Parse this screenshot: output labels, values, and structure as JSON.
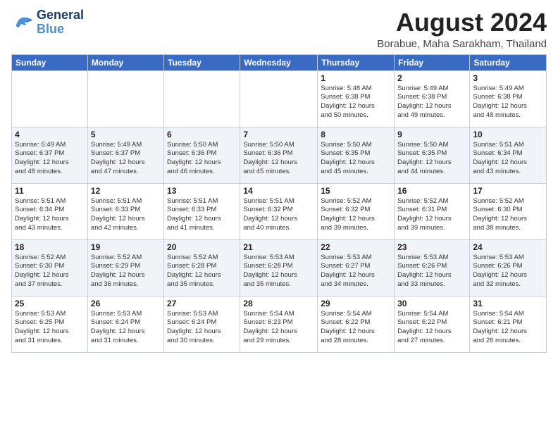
{
  "header": {
    "logo_line1": "General",
    "logo_line2": "Blue",
    "main_title": "August 2024",
    "subtitle": "Borabue, Maha Sarakham, Thailand"
  },
  "days_of_week": [
    "Sunday",
    "Monday",
    "Tuesday",
    "Wednesday",
    "Thursday",
    "Friday",
    "Saturday"
  ],
  "weeks": [
    [
      {
        "day": "",
        "info": ""
      },
      {
        "day": "",
        "info": ""
      },
      {
        "day": "",
        "info": ""
      },
      {
        "day": "",
        "info": ""
      },
      {
        "day": "1",
        "info": "Sunrise: 5:48 AM\nSunset: 6:38 PM\nDaylight: 12 hours\nand 50 minutes."
      },
      {
        "day": "2",
        "info": "Sunrise: 5:49 AM\nSunset: 6:38 PM\nDaylight: 12 hours\nand 49 minutes."
      },
      {
        "day": "3",
        "info": "Sunrise: 5:49 AM\nSunset: 6:38 PM\nDaylight: 12 hours\nand 48 minutes."
      }
    ],
    [
      {
        "day": "4",
        "info": "Sunrise: 5:49 AM\nSunset: 6:37 PM\nDaylight: 12 hours\nand 48 minutes."
      },
      {
        "day": "5",
        "info": "Sunrise: 5:49 AM\nSunset: 6:37 PM\nDaylight: 12 hours\nand 47 minutes."
      },
      {
        "day": "6",
        "info": "Sunrise: 5:50 AM\nSunset: 6:36 PM\nDaylight: 12 hours\nand 46 minutes."
      },
      {
        "day": "7",
        "info": "Sunrise: 5:50 AM\nSunset: 6:36 PM\nDaylight: 12 hours\nand 45 minutes."
      },
      {
        "day": "8",
        "info": "Sunrise: 5:50 AM\nSunset: 6:35 PM\nDaylight: 12 hours\nand 45 minutes."
      },
      {
        "day": "9",
        "info": "Sunrise: 5:50 AM\nSunset: 6:35 PM\nDaylight: 12 hours\nand 44 minutes."
      },
      {
        "day": "10",
        "info": "Sunrise: 5:51 AM\nSunset: 6:34 PM\nDaylight: 12 hours\nand 43 minutes."
      }
    ],
    [
      {
        "day": "11",
        "info": "Sunrise: 5:51 AM\nSunset: 6:34 PM\nDaylight: 12 hours\nand 43 minutes."
      },
      {
        "day": "12",
        "info": "Sunrise: 5:51 AM\nSunset: 6:33 PM\nDaylight: 12 hours\nand 42 minutes."
      },
      {
        "day": "13",
        "info": "Sunrise: 5:51 AM\nSunset: 6:33 PM\nDaylight: 12 hours\nand 41 minutes."
      },
      {
        "day": "14",
        "info": "Sunrise: 5:51 AM\nSunset: 6:32 PM\nDaylight: 12 hours\nand 40 minutes."
      },
      {
        "day": "15",
        "info": "Sunrise: 5:52 AM\nSunset: 6:32 PM\nDaylight: 12 hours\nand 39 minutes."
      },
      {
        "day": "16",
        "info": "Sunrise: 5:52 AM\nSunset: 6:31 PM\nDaylight: 12 hours\nand 39 minutes."
      },
      {
        "day": "17",
        "info": "Sunrise: 5:52 AM\nSunset: 6:30 PM\nDaylight: 12 hours\nand 38 minutes."
      }
    ],
    [
      {
        "day": "18",
        "info": "Sunrise: 5:52 AM\nSunset: 6:30 PM\nDaylight: 12 hours\nand 37 minutes."
      },
      {
        "day": "19",
        "info": "Sunrise: 5:52 AM\nSunset: 6:29 PM\nDaylight: 12 hours\nand 36 minutes."
      },
      {
        "day": "20",
        "info": "Sunrise: 5:52 AM\nSunset: 6:28 PM\nDaylight: 12 hours\nand 35 minutes."
      },
      {
        "day": "21",
        "info": "Sunrise: 5:53 AM\nSunset: 6:28 PM\nDaylight: 12 hours\nand 35 minutes."
      },
      {
        "day": "22",
        "info": "Sunrise: 5:53 AM\nSunset: 6:27 PM\nDaylight: 12 hours\nand 34 minutes."
      },
      {
        "day": "23",
        "info": "Sunrise: 5:53 AM\nSunset: 6:26 PM\nDaylight: 12 hours\nand 33 minutes."
      },
      {
        "day": "24",
        "info": "Sunrise: 5:53 AM\nSunset: 6:26 PM\nDaylight: 12 hours\nand 32 minutes."
      }
    ],
    [
      {
        "day": "25",
        "info": "Sunrise: 5:53 AM\nSunset: 6:25 PM\nDaylight: 12 hours\nand 31 minutes."
      },
      {
        "day": "26",
        "info": "Sunrise: 5:53 AM\nSunset: 6:24 PM\nDaylight: 12 hours\nand 31 minutes."
      },
      {
        "day": "27",
        "info": "Sunrise: 5:53 AM\nSunset: 6:24 PM\nDaylight: 12 hours\nand 30 minutes."
      },
      {
        "day": "28",
        "info": "Sunrise: 5:54 AM\nSunset: 6:23 PM\nDaylight: 12 hours\nand 29 minutes."
      },
      {
        "day": "29",
        "info": "Sunrise: 5:54 AM\nSunset: 6:22 PM\nDaylight: 12 hours\nand 28 minutes."
      },
      {
        "day": "30",
        "info": "Sunrise: 5:54 AM\nSunset: 6:22 PM\nDaylight: 12 hours\nand 27 minutes."
      },
      {
        "day": "31",
        "info": "Sunrise: 5:54 AM\nSunset: 6:21 PM\nDaylight: 12 hours\nand 26 minutes."
      }
    ]
  ]
}
